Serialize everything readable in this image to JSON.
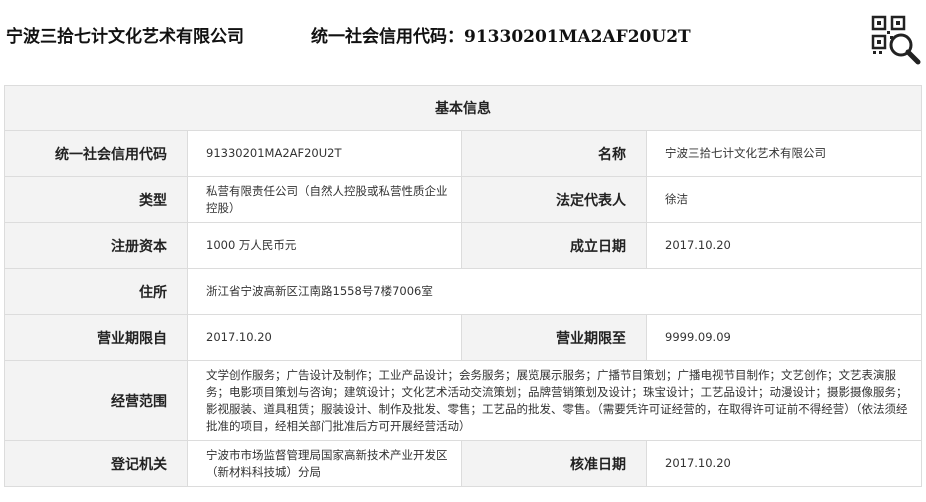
{
  "header": {
    "company_name": "宁波三拾七计文化艺术有限公司",
    "credit_line": "统一社会信用代码：91330201MA2AF20U2T",
    "qr_icon": "qr-search-icon"
  },
  "table": {
    "title": "基本信息",
    "credit_code_label": "统一社会信用代码",
    "credit_code_value": "91330201MA2AF20U2T",
    "name_label": "名称",
    "name_value": "宁波三拾七计文化艺术有限公司",
    "type_label": "类型",
    "type_value": "私营有限责任公司（自然人控股或私营性质企业控股）",
    "legal_rep_label": "法定代表人",
    "legal_rep_value": "徐洁",
    "capital_label": "注册资本",
    "capital_value": "1000 万人民币元",
    "established_label": "成立日期",
    "established_value": "2017.10.20",
    "address_label": "住所",
    "address_value": "浙江省宁波高新区江南路1558号7楼7006室",
    "term_from_label": "营业期限自",
    "term_from_value": "2017.10.20",
    "term_to_label": "营业期限至",
    "term_to_value": "9999.09.09",
    "scope_label": "经营范围",
    "scope_value": "文学创作服务；广告设计及制作；工业产品设计；会务服务；展览展示服务；广播节目策划；广播电视节目制作；文艺创作；文艺表演服务；电影项目策划与咨询；建筑设计；文化艺术活动交流策划；品牌营销策划及设计；珠宝设计；工艺品设计；动漫设计；摄影摄像服务；影视服装、道具租赁；服装设计、制作及批发、零售；工艺品的批发、零售。（需要凭许可证经营的，在取得许可证前不得经营）（依法须经批准的项目，经相关部门批准后方可开展经营活动）",
    "authority_label": "登记机关",
    "authority_value": "宁波市市场监督管理局国家高新技术产业开发区（新材料科技城）分局",
    "approval_label": "核准日期",
    "approval_value": "2017.10.20"
  }
}
